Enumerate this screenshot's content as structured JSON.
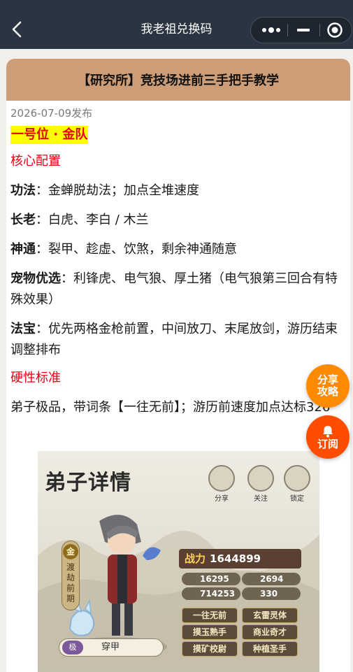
{
  "navbar": {
    "title": "我老祖兑换码"
  },
  "article": {
    "header_title": "【研究所】竞技场进前三手把手教学",
    "date": "2026-07-09发布",
    "position_heading": "一号位 · 金队",
    "core_config_heading": "核心配置",
    "items": [
      {
        "label": "功法",
        "sep": "：",
        "text": "金蝉脱劫法；加点全堆速度"
      },
      {
        "label": "长老",
        "sep": "：",
        "text": "白虎、李白 / 木兰"
      },
      {
        "label": "神通",
        "sep": "：",
        "text": "裂甲、趁虚、饮煞，剩余神通随意"
      },
      {
        "label": "宠物优选",
        "sep": "：",
        "text": "利锋虎、电气狼、厚土猪（电气狼第三回合有特殊效果）"
      },
      {
        "label": "法宝",
        "sep": "：",
        "text": "优先两格金枪前置，中间放刀、末尾放剑，游历结束调整排布"
      }
    ],
    "hard_standard_heading": "硬性标准",
    "hard_standard_text": "弟子极品，带词条【一往无前】；游历前速度加点达标326"
  },
  "floating": {
    "share_line1": "分享",
    "share_line2": "攻略",
    "subscribe": "订阅"
  },
  "screenshot": {
    "title": "弟子详情",
    "icons": [
      "分享",
      "关注",
      "锁定"
    ],
    "grade_badge": "金",
    "grade_text": "渡劫前期",
    "power_label": "战力",
    "power_value": "1644899",
    "stats": [
      "16295",
      "2694",
      "714253",
      "330"
    ],
    "tags": [
      "一往无前",
      "玄雷灵体",
      "摸玉熟手",
      "商业奇才",
      "摸矿校尉",
      "种植圣手"
    ],
    "equip_badge": "极",
    "equip_text": "穿甲"
  },
  "colors": {
    "navbar_bg": "#2b3441",
    "header_bg": "#cd9d78",
    "accent_red": "#e60012",
    "highlight_yellow": "#ffff00",
    "share_orange": "#ff8a00",
    "subscribe_orange": "#ff4d00"
  }
}
